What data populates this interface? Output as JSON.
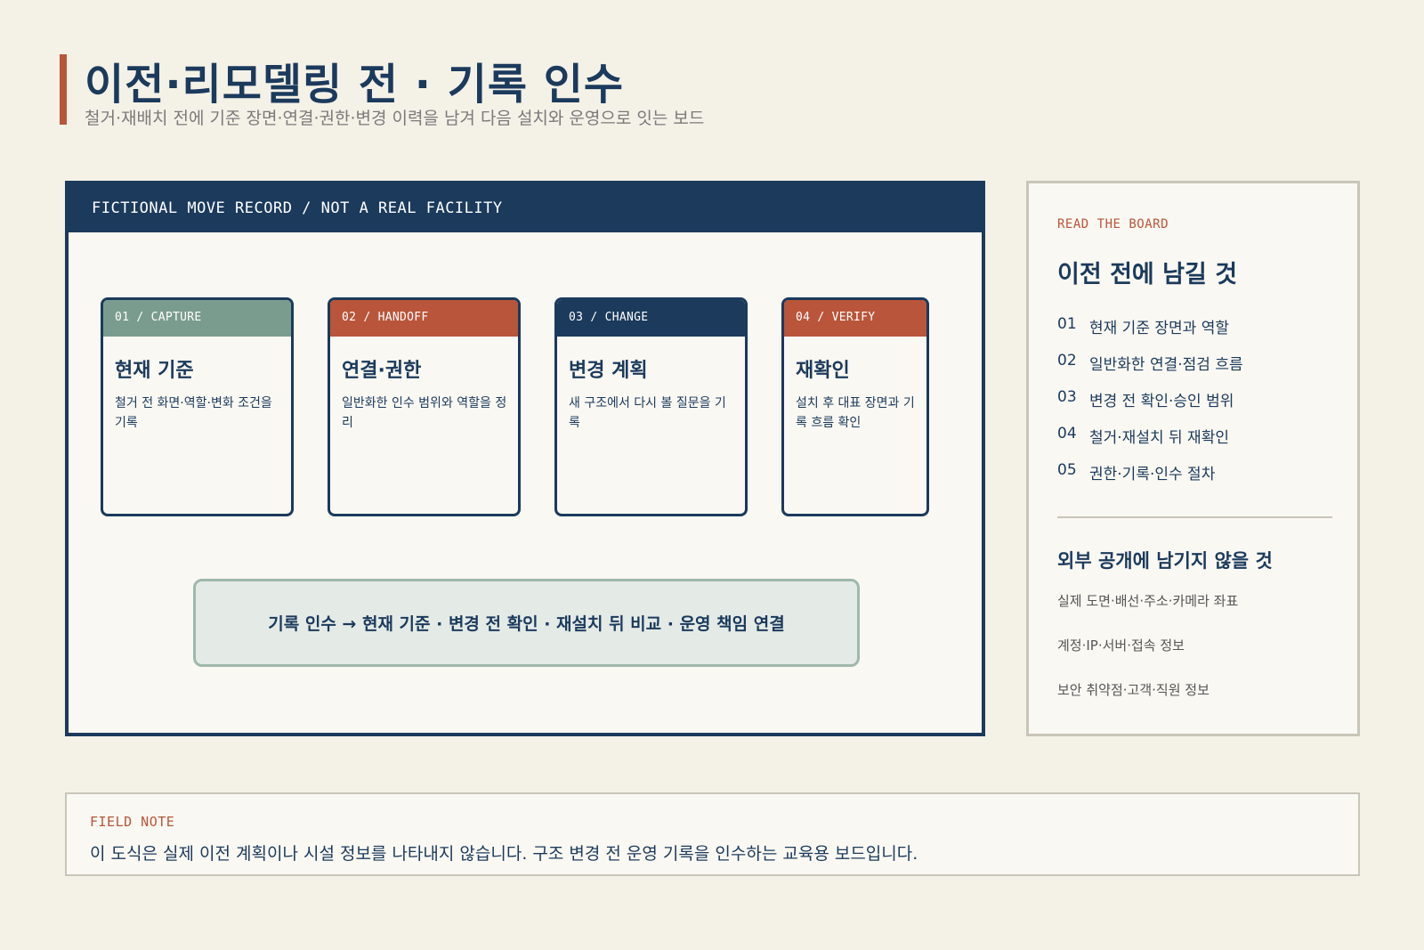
{
  "header": {
    "title": "이전·리모델링 전 · 기록 인수",
    "subtitle": "철거·재배치 전에 기준 장면·연결·권한·변경 이력을 남겨 다음 설치와 운영으로 잇는 보드"
  },
  "board": {
    "head": "FICTIONAL MOVE RECORD / NOT A REAL FACILITY",
    "cards": [
      {
        "tab": "01 / CAPTURE",
        "title": "현재 기준",
        "desc": "철거 전 화면·역할·변화 조건을 기록",
        "color": "#7a9c8e"
      },
      {
        "tab": "02 / HANDOFF",
        "title": "연결·권한",
        "desc": "일반화한 인수 범위와 역할을 정리",
        "color": "#b9553a"
      },
      {
        "tab": "03 / CHANGE",
        "title": "변경 계획",
        "desc": "새 구조에서 다시 볼 질문을 기록",
        "color": "#1b3a5c"
      },
      {
        "tab": "04 / VERIFY",
        "title": "재확인",
        "desc": "설치 후 대표 장면과 기록 흐름 확인",
        "color": "#b9553a"
      }
    ],
    "flow": "기록 인수 → 현재 기준 · 변경 전 확인 · 재설치 뒤 비교 · 운영 책임 연결"
  },
  "side": {
    "eyebrow": "READ THE BOARD",
    "title": "이전 전에 남길 것",
    "items": [
      {
        "num": "01",
        "text": "현재 기준 장면과 역할"
      },
      {
        "num": "02",
        "text": "일반화한 연결·점검 흐름"
      },
      {
        "num": "03",
        "text": "변경 전 확인·승인 범위"
      },
      {
        "num": "04",
        "text": "철거·재설치 뒤 재확인"
      },
      {
        "num": "05",
        "text": "권한·기록·인수 절차"
      }
    ],
    "subtitle": "외부 공개에 남기지 않을 것",
    "excluded": [
      "실제 도면·배선·주소·카메라 좌표",
      "계정·IP·서버·접속 정보",
      "보안 취약점·고객·직원 정보"
    ]
  },
  "note": {
    "label": "FIELD NOTE",
    "text": "이 도식은 실제 이전 계획이나 시설 정보를 나타내지 않습니다. 구조 변경 전 운영 기록을 인수하는 교육용 보드입니다."
  },
  "colors": {
    "navy": "#1b3a5c",
    "accent": "#b9553a",
    "sage": "#7a9c8e",
    "background": "#f4f1e7"
  }
}
